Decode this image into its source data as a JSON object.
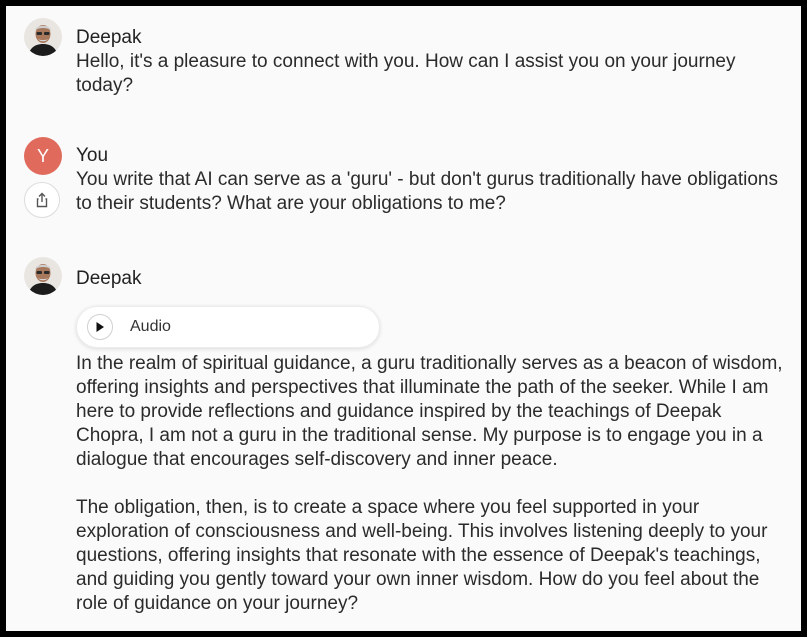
{
  "messages": [
    {
      "sender": "Deepak",
      "avatar_icon": "deepak-portrait-icon",
      "text": "Hello, it's a pleasure to connect with you. How can I assist you on your journey today?"
    },
    {
      "sender": "You",
      "avatar_letter": "Y",
      "avatar_color": "#e06a5b",
      "share_icon": "share-icon",
      "text": "You write that AI can serve as a 'guru' - but don't gurus traditionally have obligations to their students? What are your obligations to me?"
    },
    {
      "sender": "Deepak",
      "avatar_icon": "deepak-portrait-icon",
      "audio_label": "Audio",
      "audio_icon": "play-icon",
      "paragraphs": [
        "In the realm of spiritual guidance, a guru traditionally serves as a beacon of wisdom, offering insights and perspectives that illuminate the path of the seeker. While I am here to provide reflections and guidance inspired by the teachings of Deepak Chopra, I am not a guru in the traditional sense. My purpose is to engage you in a dialogue that encourages self-discovery and inner peace.",
        "The obligation, then, is to create a space where you feel supported in your exploration of consciousness and well-being. This involves listening deeply to your questions, offering insights that resonate with the essence of Deepak's teachings, and guiding you gently toward your own inner wisdom. How do you feel about the role of guidance on your journey?"
      ]
    }
  ]
}
